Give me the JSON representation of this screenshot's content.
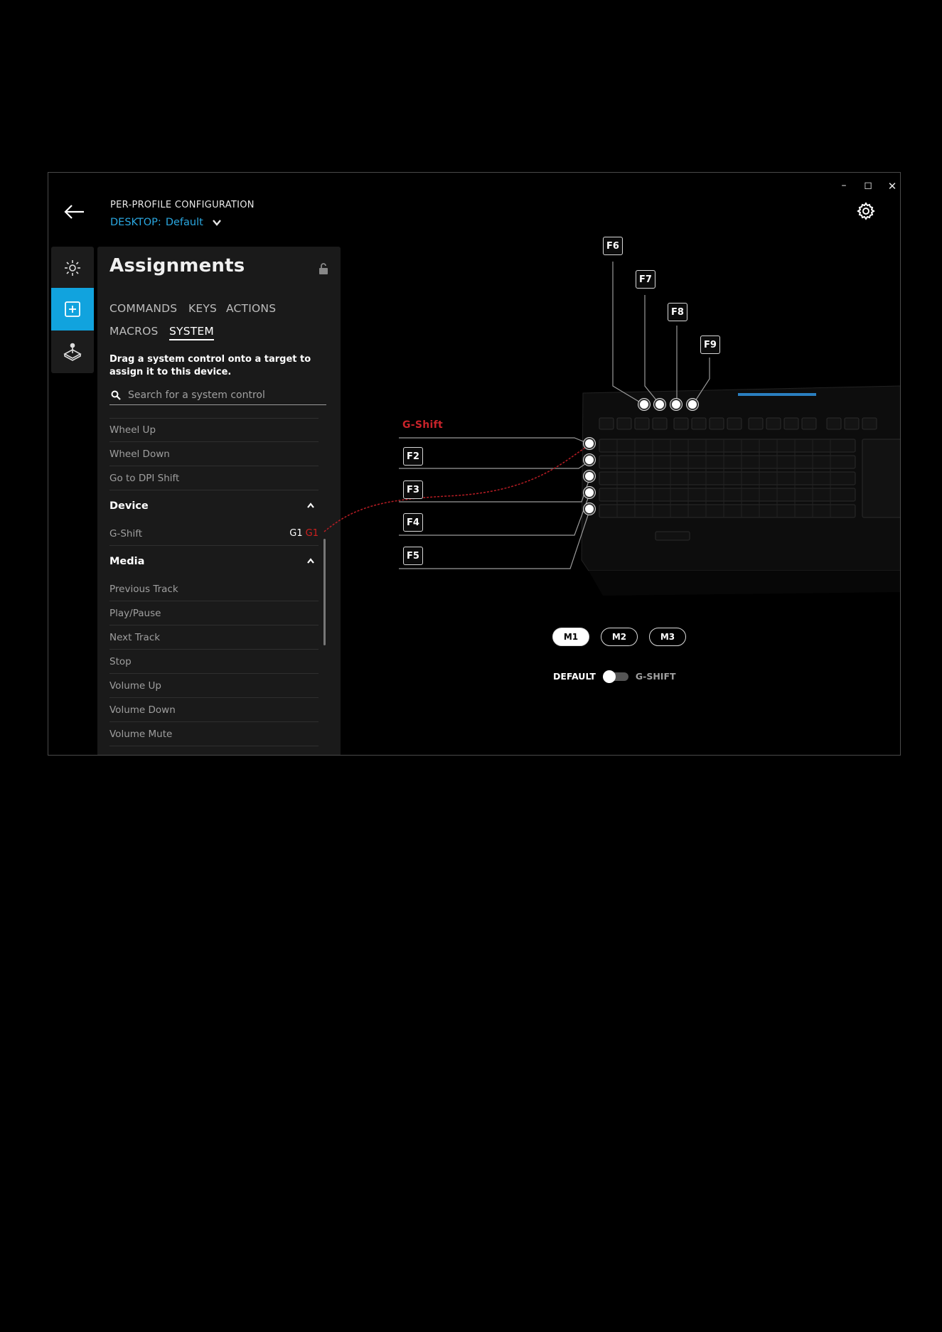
{
  "window": {
    "minimize_icon": "minimize-icon",
    "maximize_icon": "maximize-icon",
    "close_icon": "close-icon"
  },
  "header": {
    "title": "PER-PROFILE CONFIGURATION",
    "profile_label": "DESKTOP:",
    "profile_name": "Default",
    "back_icon": "arrow-left-icon",
    "settings_icon": "gear-icon"
  },
  "rail": {
    "items": [
      {
        "name": "lighting",
        "icon": "sun-icon",
        "active": false
      },
      {
        "name": "assignments",
        "icon": "plus-square-icon",
        "active": true
      },
      {
        "name": "game-mode",
        "icon": "joystick-icon",
        "active": false
      }
    ]
  },
  "panel": {
    "title": "Assignments",
    "lock_icon": "unlock-icon",
    "tabs": [
      "COMMANDS",
      "KEYS",
      "ACTIONS",
      "MACROS",
      "SYSTEM"
    ],
    "active_tab": "SYSTEM",
    "hint": "Drag a system control onto a target to assign it to this device.",
    "search_placeholder": "Search for a system control",
    "mouse_items": [
      "Wheel Up",
      "Wheel Down",
      "Go to DPI Shift"
    ],
    "device_section": "Device",
    "device_items": [
      {
        "label": "G-Shift",
        "assign1": "G1",
        "assign2": "G1"
      }
    ],
    "media_section": "Media",
    "media_items": [
      "Previous Track",
      "Play/Pause",
      "Next Track",
      "Stop",
      "Volume Up",
      "Volume Down",
      "Volume Mute"
    ]
  },
  "keyboard": {
    "gshift_label": "G-Shift",
    "left_keys": [
      "F2",
      "F3",
      "F4",
      "F5"
    ],
    "top_keys": [
      "F6",
      "F7",
      "F8",
      "F9"
    ]
  },
  "memory": {
    "buttons": [
      "M1",
      "M2",
      "M3"
    ],
    "active": "M1"
  },
  "mode_toggle": {
    "left": "DEFAULT",
    "right": "G-SHIFT",
    "state": "default"
  },
  "colors": {
    "accent": "#11a3de",
    "gshift_red": "#c8232a"
  }
}
